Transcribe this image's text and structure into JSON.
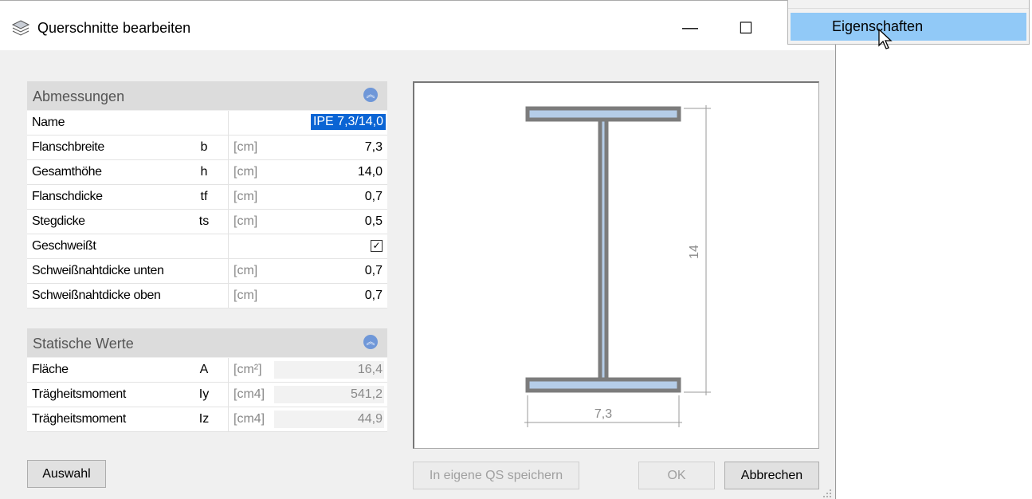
{
  "window": {
    "title": "Querschnitte bearbeiten",
    "minimize_glyph": "—",
    "maximize_glyph": "☐"
  },
  "context_menu": {
    "selected_item": "Eigenschaften"
  },
  "property_grid": {
    "categories": [
      {
        "label": "Abmessungen"
      },
      {
        "label": "Statische Werte"
      }
    ],
    "rows": [
      {
        "label": "Name",
        "symbol": "",
        "unit": "",
        "value": "IPE 7,3/14,0"
      },
      {
        "label": "Flanschbreite",
        "symbol": "b",
        "unit": "[cm]",
        "value": "7,3"
      },
      {
        "label": "Gesamthöhe",
        "symbol": "h",
        "unit": "[cm]",
        "value": "14,0"
      },
      {
        "label": "Flanschdicke",
        "symbol": "tf",
        "unit": "[cm]",
        "value": "0,7"
      },
      {
        "label": "Stegdicke",
        "symbol": "ts",
        "unit": "[cm]",
        "value": "0,5"
      },
      {
        "label": "Geschweißt",
        "symbol": "",
        "unit": "",
        "value": "",
        "checked": true
      },
      {
        "label": "Schweißnahtdicke unten",
        "symbol": "",
        "unit": "[cm]",
        "value": "0,7"
      },
      {
        "label": "Schweißnahtdicke oben",
        "symbol": "",
        "unit": "[cm]",
        "value": "0,7"
      },
      {
        "label": "Fläche",
        "symbol": "A",
        "unit": "[cm²]",
        "value": "16,4"
      },
      {
        "label": "Trägheitsmoment",
        "symbol": "Iy",
        "unit": "[cm4]",
        "value": "541,2"
      },
      {
        "label": "Trägheitsmoment",
        "symbol": "Iz",
        "unit": "[cm4]",
        "value": "44,9"
      }
    ]
  },
  "preview": {
    "width_label": "7,3",
    "height_label": "14"
  },
  "buttons": {
    "auswahl": "Auswahl",
    "save": "In eigene QS speichern",
    "ok": "OK",
    "cancel": "Abbrechen"
  },
  "icons": {
    "app": "layers-icon",
    "collapse": "chevron-up-circle-icon",
    "cursor": "mouse-pointer-icon",
    "grip": "resize-grip-icon"
  },
  "colors": {
    "selection": "#0a64d4",
    "menu_highlight": "#91c9f7",
    "profile_fill": "#b5cde8",
    "profile_stroke": "#7c7c7c"
  }
}
